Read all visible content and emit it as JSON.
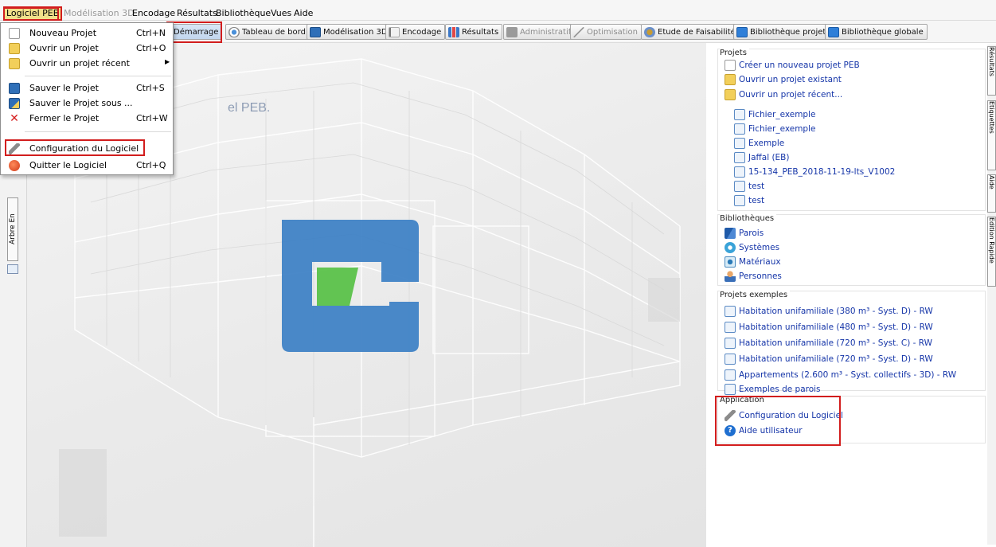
{
  "menubar": {
    "items": [
      "Logiciel PEB",
      "Modélisation 3D",
      "Encodage",
      "Résultats",
      "Bibliothèque",
      "Vues",
      "Aide"
    ]
  },
  "toolbar": {
    "buttons": [
      "Démarrage",
      "Tableau de bord",
      "Modélisation 3D",
      "Encodage",
      "Résultats",
      "Administratif",
      "Optimisation",
      "Etude de Faisabilité",
      "Bibliothèque projet",
      "Bibliothèque globale"
    ]
  },
  "file_menu": {
    "items": [
      {
        "label": "Nouveau Projet",
        "shortcut": "Ctrl+N",
        "icon": "new-document-icon"
      },
      {
        "label": "Ouvrir un Projet",
        "shortcut": "Ctrl+O",
        "icon": "folder-open-icon"
      },
      {
        "label": "Ouvrir un projet récent",
        "shortcut": "",
        "icon": "recent-folder-icon"
      },
      {
        "label": "Sauver le Projet",
        "shortcut": "Ctrl+S",
        "icon": "save-icon"
      },
      {
        "label": "Sauver le Projet sous ...",
        "shortcut": "",
        "icon": "save-as-icon"
      },
      {
        "label": "Fermer le Projet",
        "shortcut": "Ctrl+W",
        "icon": "close-x-icon"
      },
      {
        "label": "Configuration du Logiciel",
        "shortcut": "",
        "icon": "wrench-icon"
      },
      {
        "label": "Quitter le Logiciel",
        "shortcut": "Ctrl+Q",
        "icon": "quit-icon"
      }
    ]
  },
  "viewport": {
    "background_title": "el PEB."
  },
  "left_dock": {
    "tab_label": "Arbre En"
  },
  "right_panel": {
    "projets": {
      "title": "Projets",
      "create": "Créer un nouveau projet PEB",
      "open_existing": "Ouvrir un projet existant",
      "open_recent": "Ouvrir un projet récent...",
      "recent_files": [
        "Fichier_exemple",
        "Fichier_exemple",
        "Exemple",
        "Jaffal (EB)",
        "15-134_PEB_2018-11-19-lts_V1002",
        "test",
        "test"
      ]
    },
    "bibliotheques": {
      "title": "Bibliothèques",
      "items": [
        "Parois",
        "Systèmes",
        "Matériaux",
        "Personnes"
      ]
    },
    "projets_exemples": {
      "title": "Projets exemples",
      "items": [
        "Habitation unifamiliale (380 m³ - Syst. D) - RW",
        "Habitation unifamiliale (480 m³ - Syst. D) - RW",
        "Habitation unifamiliale (720 m³ - Syst. C) - RW",
        "Habitation unifamiliale (720 m³ - Syst. D) - RW",
        "Appartements (2.600 m³ - Syst. collectifs - 3D) - RW",
        "Exemples de parois"
      ]
    },
    "application": {
      "title": "Application",
      "items": [
        "Configuration du Logiciel",
        "Aide utilisateur"
      ]
    }
  },
  "right_dock": {
    "tabs": [
      "Résultats",
      "Etiquettes",
      "Aide",
      "Edition Rapide"
    ]
  },
  "colors": {
    "highlight_box": "#d21d1d",
    "logo_blue": "#3b7fc4",
    "logo_green": "#5bc24a",
    "link_blue": "#1535a8"
  }
}
